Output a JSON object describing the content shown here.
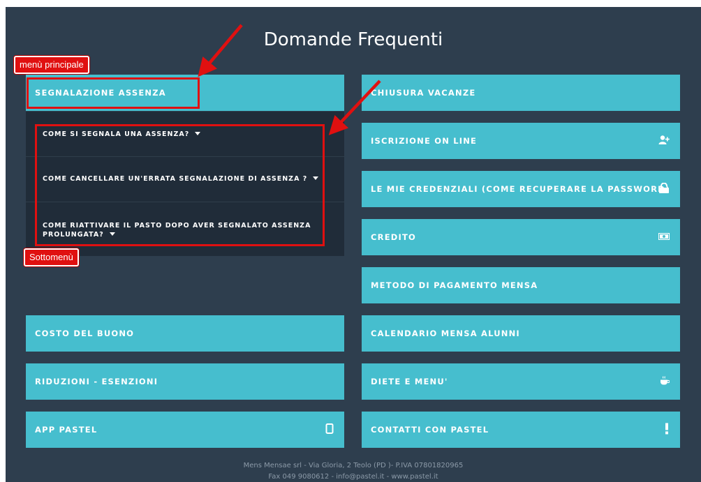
{
  "title": "Domande Frequenti",
  "left_menu": [
    {
      "label": "SEGNALAZIONE ASSENZA"
    },
    {
      "label": "COSTO DEL BUONO"
    },
    {
      "label": "RIDUZIONI - ESENZIONI"
    },
    {
      "label": "APP PASTEL",
      "icon": "tablet-icon"
    }
  ],
  "submenu": [
    {
      "label": "COME SI SEGNALA UNA ASSENZA?"
    },
    {
      "label": "COME CANCELLARE UN'ERRATA SEGNALAZIONE DI ASSENZA ?"
    },
    {
      "label_line1": "COME RIATTIVARE IL PASTO DOPO AVER SEGNALATO ASSENZA",
      "label_line2": "PROLUNGATA?"
    }
  ],
  "right_menu": [
    {
      "label": "CHIUSURA VACANZE"
    },
    {
      "label": "ISCRIZIONE ON LINE",
      "icon": "add-user-icon"
    },
    {
      "label": "LE MIE CREDENZIALI (COME RECUPERARE LA PASSWORD)",
      "icon": "unlock-icon"
    },
    {
      "label": "CREDITO",
      "icon": "money-icon"
    },
    {
      "label": "METODO DI PAGAMENTO MENSA"
    },
    {
      "label": "CALENDARIO MENSA ALUNNI"
    },
    {
      "label": "DIETE E MENU'",
      "icon": "coffee-icon"
    },
    {
      "label": "CONTATTI CON PASTEL",
      "icon": "exclamation-icon"
    }
  ],
  "annotations": {
    "main_menu_label": "menù principale",
    "submenu_label": "Sottomenù",
    "color": "#e01010"
  },
  "footer": {
    "line1": "Mens Mensae srl - Via Gloria, 2 Teolo (PD )- P.IVA 07801820965",
    "line2": "Fax 049 9080612 - info@pastel.it - www.pastel.it"
  },
  "colors": {
    "background": "#2e3e4e",
    "tile": "#46bece",
    "submenu_bg": "#202c39"
  }
}
